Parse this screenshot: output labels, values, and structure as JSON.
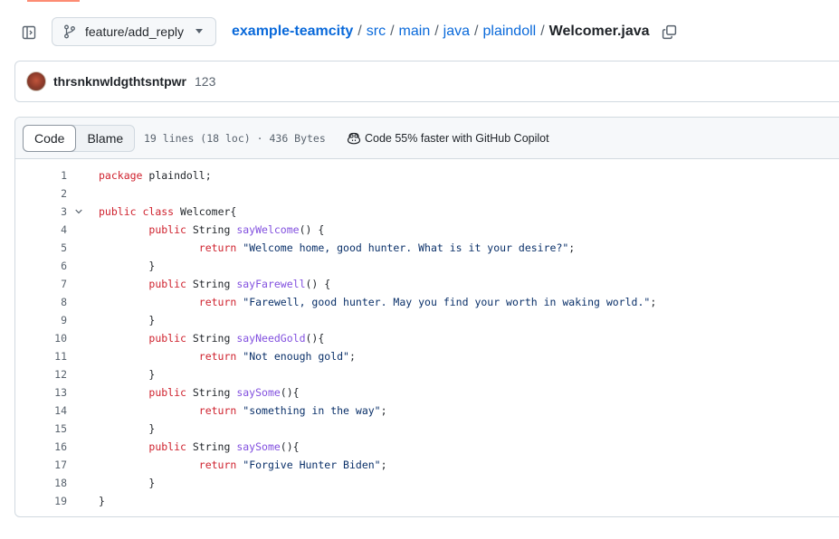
{
  "header": {
    "branch": "feature/add_reply",
    "breadcrumb": {
      "repo": "example-teamcity",
      "segments": [
        "src",
        "main",
        "java",
        "plaindoll"
      ],
      "file": "Welcomer.java",
      "separator": "/"
    }
  },
  "commit": {
    "user": "thrsnknwldgthtsntpwr",
    "count": "123"
  },
  "file": {
    "tabs": [
      "Code",
      "Blame"
    ],
    "active_tab": "Code",
    "meta": "19 lines (18 loc) · 436 Bytes",
    "copilot": "Code 55% faster with GitHub Copilot",
    "lines": [
      {
        "n": "1",
        "tokens": [
          {
            "t": "package",
            "c": "kw"
          },
          {
            "t": " plaindoll;",
            "c": ""
          }
        ]
      },
      {
        "n": "2",
        "tokens": []
      },
      {
        "n": "3",
        "fold": true,
        "tokens": [
          {
            "t": "public",
            "c": "kw"
          },
          {
            "t": " ",
            "c": ""
          },
          {
            "t": "class",
            "c": "kw"
          },
          {
            "t": " Welcomer{",
            "c": ""
          }
        ]
      },
      {
        "n": "4",
        "tokens": [
          {
            "t": "        ",
            "c": ""
          },
          {
            "t": "public",
            "c": "kw"
          },
          {
            "t": " String ",
            "c": ""
          },
          {
            "t": "sayWelcome",
            "c": "fn"
          },
          {
            "t": "() {",
            "c": ""
          }
        ]
      },
      {
        "n": "5",
        "tokens": [
          {
            "t": "                ",
            "c": ""
          },
          {
            "t": "return",
            "c": "kw"
          },
          {
            "t": " ",
            "c": ""
          },
          {
            "t": "\"Welcome home, good hunter. What is it your desire?\"",
            "c": "str"
          },
          {
            "t": ";",
            "c": ""
          }
        ]
      },
      {
        "n": "6",
        "tokens": [
          {
            "t": "        }",
            "c": ""
          }
        ]
      },
      {
        "n": "7",
        "tokens": [
          {
            "t": "        ",
            "c": ""
          },
          {
            "t": "public",
            "c": "kw"
          },
          {
            "t": " String ",
            "c": ""
          },
          {
            "t": "sayFarewell",
            "c": "fn"
          },
          {
            "t": "() {",
            "c": ""
          }
        ]
      },
      {
        "n": "8",
        "tokens": [
          {
            "t": "                ",
            "c": ""
          },
          {
            "t": "return",
            "c": "kw"
          },
          {
            "t": " ",
            "c": ""
          },
          {
            "t": "\"Farewell, good hunter. May you find your worth in waking world.\"",
            "c": "str"
          },
          {
            "t": ";",
            "c": ""
          }
        ]
      },
      {
        "n": "9",
        "tokens": [
          {
            "t": "        }",
            "c": ""
          }
        ]
      },
      {
        "n": "10",
        "tokens": [
          {
            "t": "        ",
            "c": ""
          },
          {
            "t": "public",
            "c": "kw"
          },
          {
            "t": " String ",
            "c": ""
          },
          {
            "t": "sayNeedGold",
            "c": "fn"
          },
          {
            "t": "(){",
            "c": ""
          }
        ]
      },
      {
        "n": "11",
        "tokens": [
          {
            "t": "                ",
            "c": ""
          },
          {
            "t": "return",
            "c": "kw"
          },
          {
            "t": " ",
            "c": ""
          },
          {
            "t": "\"Not enough gold\"",
            "c": "str"
          },
          {
            "t": ";",
            "c": ""
          }
        ]
      },
      {
        "n": "12",
        "tokens": [
          {
            "t": "        }",
            "c": ""
          }
        ]
      },
      {
        "n": "13",
        "tokens": [
          {
            "t": "        ",
            "c": ""
          },
          {
            "t": "public",
            "c": "kw"
          },
          {
            "t": " String ",
            "c": ""
          },
          {
            "t": "saySome",
            "c": "fn"
          },
          {
            "t": "(){",
            "c": ""
          }
        ]
      },
      {
        "n": "14",
        "tokens": [
          {
            "t": "                ",
            "c": ""
          },
          {
            "t": "return",
            "c": "kw"
          },
          {
            "t": " ",
            "c": ""
          },
          {
            "t": "\"something in the way\"",
            "c": "str"
          },
          {
            "t": ";",
            "c": ""
          }
        ]
      },
      {
        "n": "15",
        "tokens": [
          {
            "t": "        }",
            "c": ""
          }
        ]
      },
      {
        "n": "16",
        "tokens": [
          {
            "t": "        ",
            "c": ""
          },
          {
            "t": "public",
            "c": "kw"
          },
          {
            "t": " String ",
            "c": ""
          },
          {
            "t": "saySome",
            "c": "fn"
          },
          {
            "t": "(){",
            "c": ""
          }
        ]
      },
      {
        "n": "17",
        "tokens": [
          {
            "t": "                ",
            "c": ""
          },
          {
            "t": "return",
            "c": "kw"
          },
          {
            "t": " ",
            "c": ""
          },
          {
            "t": "\"Forgive Hunter Biden\"",
            "c": "str"
          },
          {
            "t": ";",
            "c": ""
          }
        ]
      },
      {
        "n": "18",
        "tokens": [
          {
            "t": "        }",
            "c": ""
          }
        ]
      },
      {
        "n": "19",
        "tokens": [
          {
            "t": "}",
            "c": ""
          }
        ]
      }
    ]
  },
  "icons": {
    "sidebar": "sidebar-expand-icon",
    "branch": "git-branch-icon",
    "caret": "triangle-down-icon",
    "copy": "copy-icon",
    "copilot": "copilot-icon",
    "fold": "chevron-down-icon"
  },
  "colors": {
    "link": "#0969da",
    "keyword": "#cf222e",
    "function": "#8250df",
    "string": "#0a3069",
    "accent": "#fd8c73"
  }
}
